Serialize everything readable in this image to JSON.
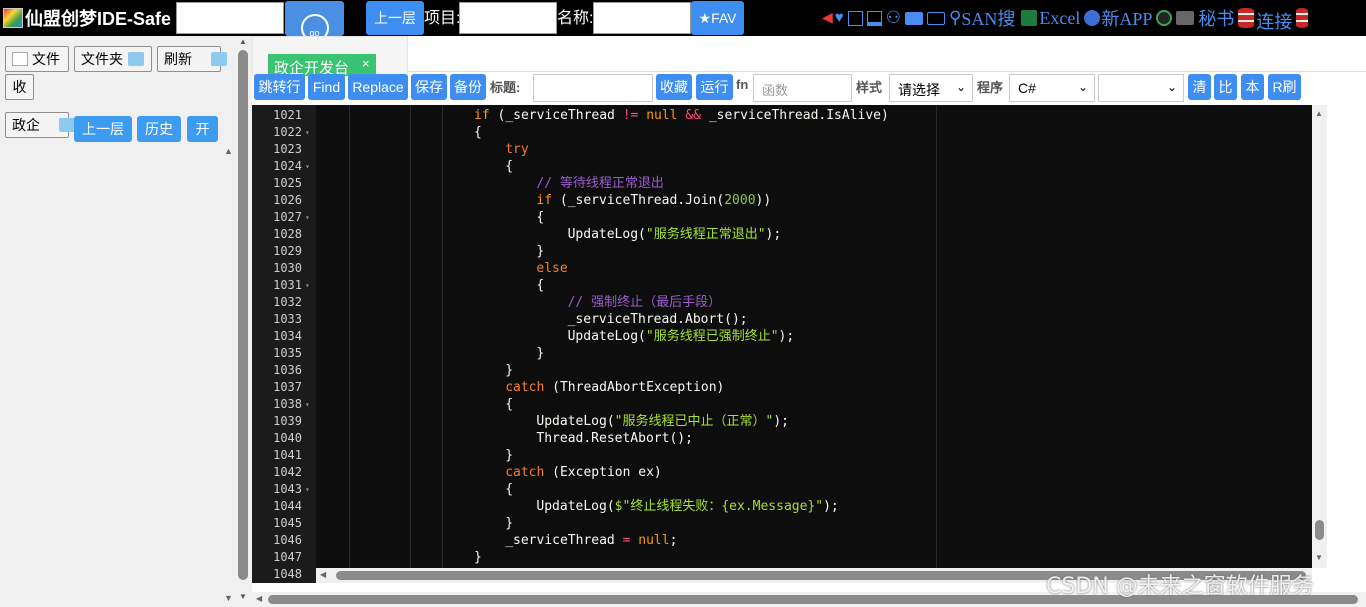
{
  "topbar": {
    "title": "仙盟创梦IDE-Safe",
    "address_value": "",
    "go_label": "go",
    "up_label": "上一层",
    "project_label": "项目:",
    "project_value": "",
    "name_label": "名称:",
    "name_value": "",
    "fav_label": "★FAV",
    "icons": [
      "left-arrow-icon",
      "heart-icon",
      "window-icon",
      "panel-icon",
      "user-icon",
      "folder-icon",
      "lock-folder-icon"
    ],
    "san_label": "SAN搜",
    "excel_label": "Excel",
    "newapp_label": "新APP",
    "secretary_label": "秘书",
    "connect_label": "连接"
  },
  "left": {
    "file_label": "文件",
    "folder_label": "文件夹",
    "refresh_label": "刷新",
    "collapse_label": "收",
    "gov_label": "政企",
    "up_label": "上一层",
    "history_label": "历史",
    "open_label": "开"
  },
  "tab": {
    "label": "政企开发台",
    "close": "×"
  },
  "toolbar": {
    "jump_label": "跳转行",
    "find_label": "Find",
    "replace_label": "Replace",
    "save_label": "保存",
    "backup_label": "备份",
    "title_label": "标题:",
    "title_value": "",
    "fav_label": "收藏",
    "run_label": "运行",
    "fn_label": "fn",
    "func_placeholder": "函数",
    "style_label": "样式",
    "style_value": "请选择",
    "program_label": "程序",
    "program_value": "C#",
    "extra_value": "",
    "clear_label": "清",
    "compare_label": "比",
    "local_label": "本",
    "rrefresh_label": "R刷"
  },
  "editor": {
    "lines": [
      {
        "n": "1021",
        "fold": false
      },
      {
        "n": "1022",
        "fold": true
      },
      {
        "n": "1023",
        "fold": false
      },
      {
        "n": "1024",
        "fold": true
      },
      {
        "n": "1025",
        "fold": false
      },
      {
        "n": "1026",
        "fold": false
      },
      {
        "n": "1027",
        "fold": true
      },
      {
        "n": "1028",
        "fold": false
      },
      {
        "n": "1029",
        "fold": false
      },
      {
        "n": "1030",
        "fold": false
      },
      {
        "n": "1031",
        "fold": true
      },
      {
        "n": "1032",
        "fold": false
      },
      {
        "n": "1033",
        "fold": false
      },
      {
        "n": "1034",
        "fold": false
      },
      {
        "n": "1035",
        "fold": false
      },
      {
        "n": "1036",
        "fold": false
      },
      {
        "n": "1037",
        "fold": false
      },
      {
        "n": "1038",
        "fold": true
      },
      {
        "n": "1039",
        "fold": false
      },
      {
        "n": "1040",
        "fold": false
      },
      {
        "n": "1041",
        "fold": false
      },
      {
        "n": "1042",
        "fold": false
      },
      {
        "n": "1043",
        "fold": true
      },
      {
        "n": "1044",
        "fold": false
      },
      {
        "n": "1045",
        "fold": false
      },
      {
        "n": "1046",
        "fold": false
      },
      {
        "n": "1047",
        "fold": false
      },
      {
        "n": "1048",
        "fold": false
      }
    ],
    "code": {
      "l1021_if": "if",
      "l1021_rest1": " (_serviceThread ",
      "l1021_op": "!=",
      "l1021_null": "null",
      "l1021_and": "&&",
      "l1021_rest2": " _serviceThread.IsAlive)",
      "brace_open": "{",
      "brace_close": "}",
      "try": "try",
      "comment1": "// 等待线程正常退出",
      "l1026_if": "if",
      "l1026_rest1": " (_serviceThread.Join(",
      "l1026_num": "2000",
      "l1026_rest2": "))",
      "update": "UpdateLog(",
      "str_normal_exit": "\"服务线程正常退出\"",
      "close_paren_semi": ");",
      "else": "else",
      "comment2": "// 强制终止（最后手段）",
      "abort": "_serviceThread.Abort();",
      "str_forced": "\"服务线程已强制终止\"",
      "catch": "catch",
      "catch1_rest": " (ThreadAbortException)",
      "str_aborted": "\"服务线程已中止（正常）\"",
      "reset": "Thread.ResetAbort();",
      "catch2_rest": " (Exception ex)",
      "str_failed": "$\"终止线程失败：{ex.Message}\"",
      "assign_lhs": "_serviceThread ",
      "assign_op": "=",
      "assign_null": "null",
      "semi": ";"
    }
  },
  "watermark": "CSDN @未来之窗软件服务",
  "colors": {
    "accent": "#3d8ef0",
    "tab": "#3ac371",
    "editor_bg": "#0d0d0d"
  }
}
